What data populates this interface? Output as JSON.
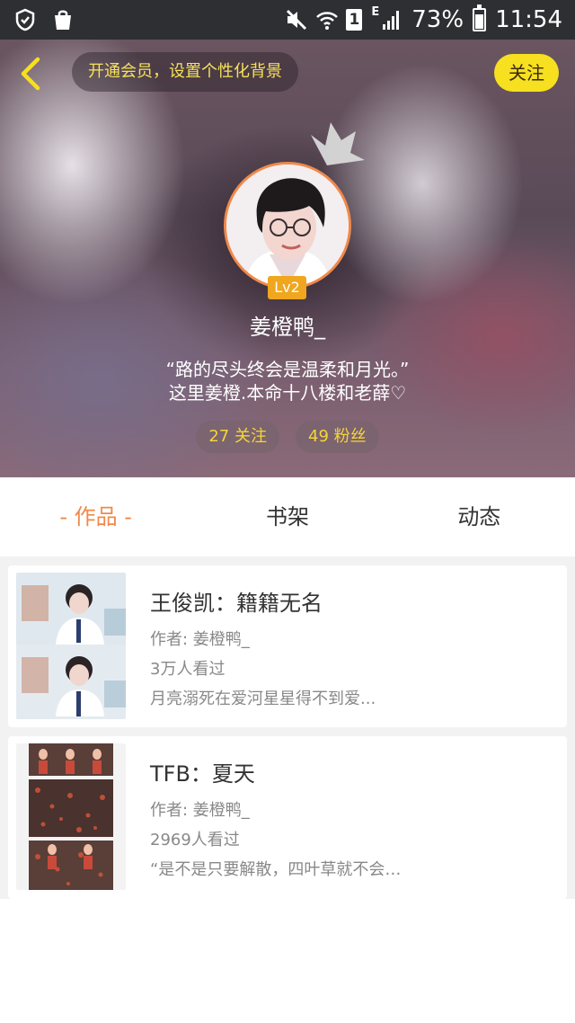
{
  "status_bar": {
    "battery": "73%",
    "time": "11:54",
    "sim_slot": "1",
    "network_type": "E",
    "icons": [
      "shield-icon",
      "shopping-bag-icon",
      "mute-icon",
      "wifi-icon",
      "signal-icon",
      "battery-icon"
    ],
    "battery_level": 0.73
  },
  "header": {
    "promo_text": "开通会员，设置个性化背景",
    "follow_label": "关注",
    "level": "Lv2",
    "username": "姜橙鸭_",
    "bio_line1": "“路的尽头终会是温柔和月光。”",
    "bio_line2": "这里姜橙.本命十八楼和老薛♡",
    "following_count": "27 关注",
    "fans_count": "49 粉丝"
  },
  "tabs": [
    {
      "label": "- 作品 -",
      "active": true
    },
    {
      "label": "书架",
      "active": false
    },
    {
      "label": "动态",
      "active": false
    }
  ],
  "works": [
    {
      "title": "王俊凯：籍籍无名",
      "author": "作者: 姜橙鸭_",
      "views": "3万人看过",
      "desc": "月亮溺死在爱河星星得不到爱..."
    },
    {
      "title": "TFB：夏天",
      "author": "作者: 姜橙鸭_",
      "views": "2969人看过",
      "desc": "“是不是只要解散，四叶草就不会被全网di…"
    }
  ],
  "colors": {
    "accent_orange": "#f0894a",
    "follow_yellow": "#f6e01f",
    "stat_yellow": "#f6d43a",
    "level_badge": "#f0a61e"
  }
}
